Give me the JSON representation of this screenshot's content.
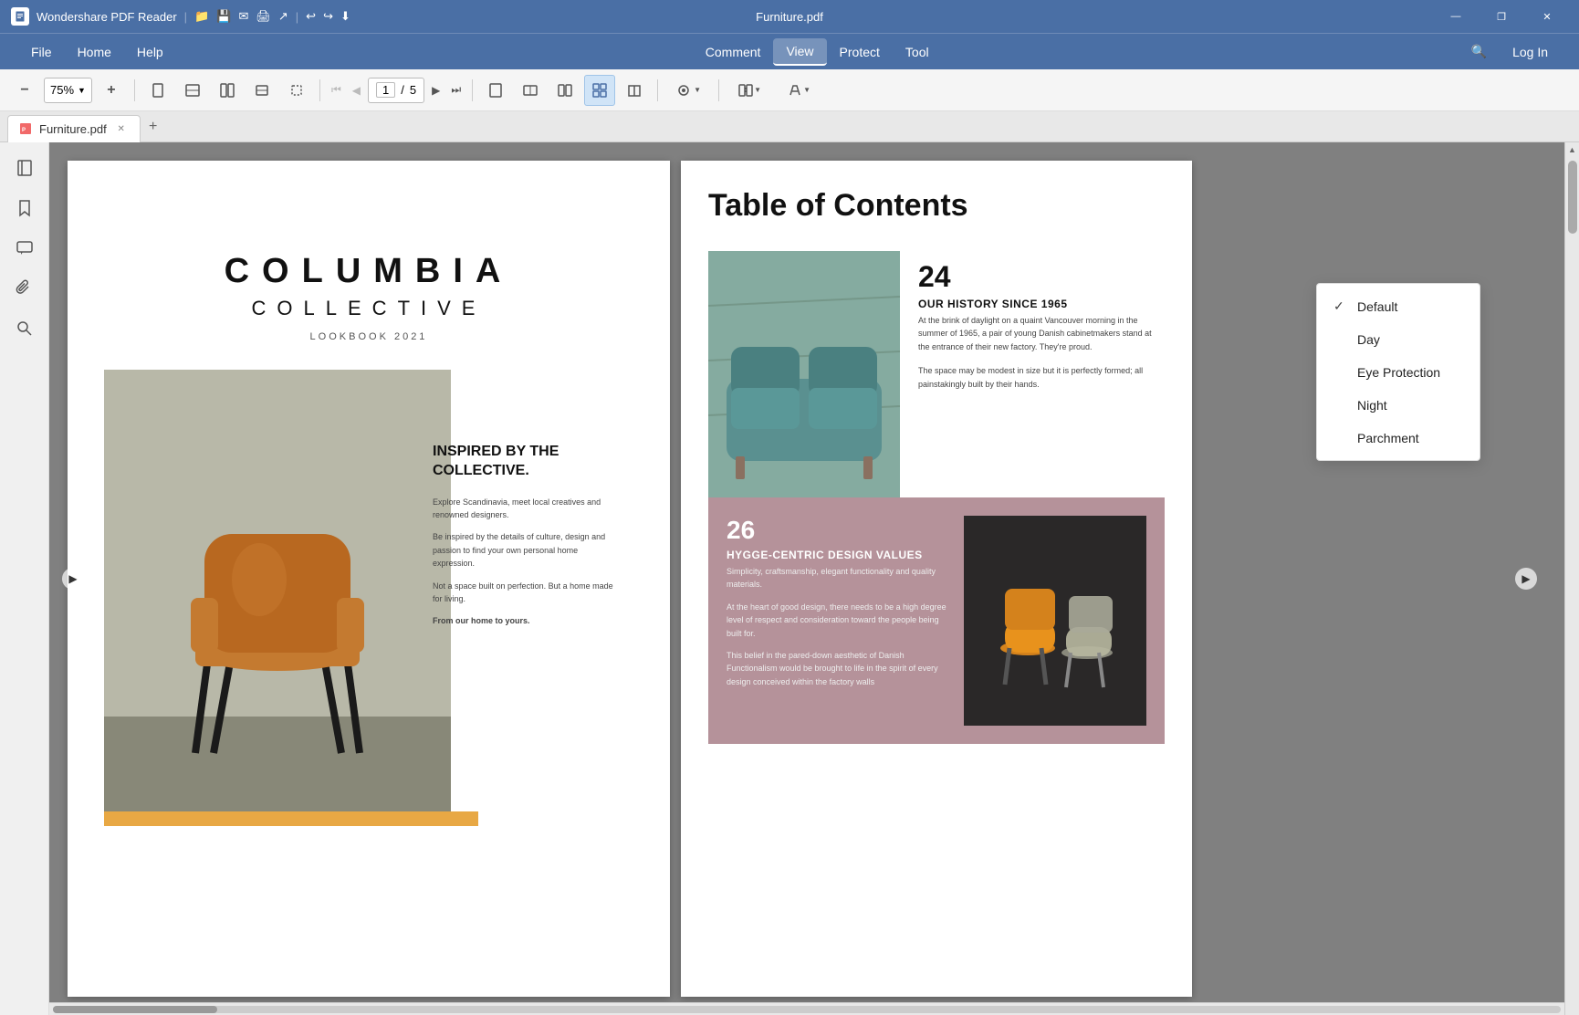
{
  "titleBar": {
    "appName": "Wondershare PDF Reader",
    "fileName": "Furniture.pdf",
    "buttons": {
      "minimize": "—",
      "restore": "❐",
      "close": "✕"
    }
  },
  "menuBar": {
    "items": [
      "File",
      "Home",
      "Help"
    ],
    "centerItems": [
      "Comment",
      "View",
      "Protect",
      "Tool"
    ],
    "activeItem": "View",
    "searchIcon": "🔍",
    "loginLabel": "Log In"
  },
  "toolbar": {
    "zoom": "75%",
    "pageNum": "1",
    "totalPages": "5"
  },
  "tabBar": {
    "tabs": [
      {
        "label": "Furniture.pdf",
        "active": true
      }
    ],
    "addLabel": "+"
  },
  "leftSidebar": {
    "icons": [
      "book",
      "bookmark",
      "comment",
      "paperclip",
      "search"
    ]
  },
  "page1": {
    "title": "COLUMBIA",
    "subtitle": "COLLECTIVE",
    "lookbook": "LOOKBOOK 2021",
    "heading": "INSPIRED BY THE COLLECTIVE.",
    "para1": "Explore Scandinavia, meet local creatives and renowned designers.",
    "para2": "Be inspired by the details of culture, design and passion to find your own personal home expression.",
    "para3": "Not a space built on perfection. But a home made for living.",
    "para4": "From our home to yours."
  },
  "page2": {
    "tableOfContents": "Table of Contents",
    "item24": {
      "number": "24",
      "heading": "OUR HISTORY SINCE 1965",
      "body1": "At the brink of daylight on a quaint Vancouver morning in the summer of 1965, a pair of young Danish cabinetmakers stand at the entrance of their new factory. They're proud.",
      "body2": "The space may be modest in size but it is perfectly formed; all painstakingly built by their hands."
    },
    "item26": {
      "number": "26",
      "heading": "HYGGE-CENTRIC DESIGN VALUES",
      "body1": "Simplicity, craftsmanship, elegant functionality and quality materials.",
      "body2": "At the heart of good design, there needs to be a high degree level of respect and consideration toward the people being built for.",
      "body3": "This belief in the pared-down aesthetic of Danish Functionalism would be brought to life in the spirit of every design conceived within the factory walls"
    }
  },
  "dropdown": {
    "items": [
      {
        "label": "Default",
        "selected": true
      },
      {
        "label": "Day",
        "selected": false
      },
      {
        "label": "Eye Protection",
        "selected": false
      },
      {
        "label": "Night",
        "selected": false
      },
      {
        "label": "Parchment",
        "selected": false
      }
    ]
  },
  "colors": {
    "titleBarBg": "#4a6fa5",
    "accentOrange": "#e8a844",
    "sofaBg": "#6ba3a0",
    "tocSectionBg": "#b5929a"
  }
}
